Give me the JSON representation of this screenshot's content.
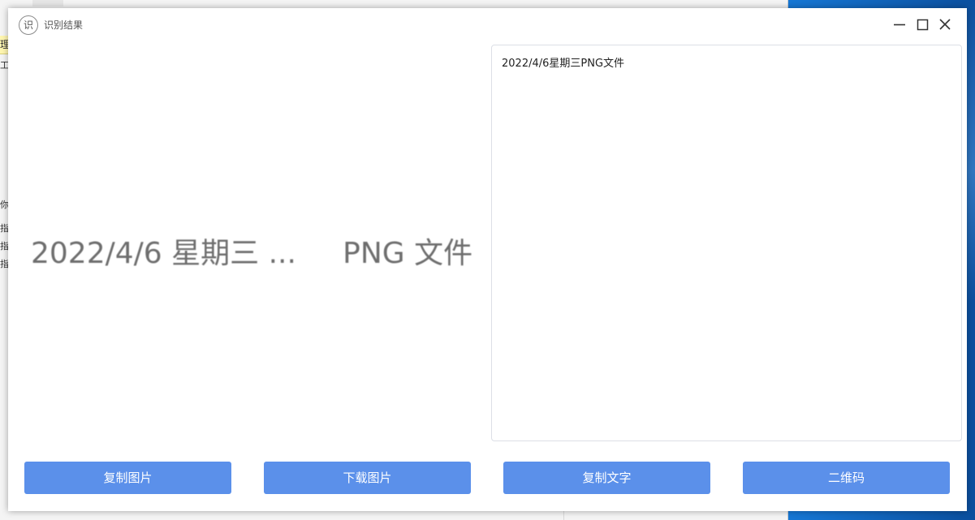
{
  "window": {
    "title": "识别结果",
    "icon_glyph": "识"
  },
  "preview": {
    "image_text": "2022/4/6 星期三 ...     PNG 文件"
  },
  "result": {
    "text": "2022/4/6星期三PNG文件"
  },
  "actions": {
    "copy_image": "复制图片",
    "download_image": "下载图片",
    "copy_text": "复制文字",
    "qrcode": "二维码"
  },
  "background_app": {
    "yellow_text": "理",
    "side_lines": [
      "工",
      "你",
      "指",
      "指",
      "指"
    ]
  },
  "colors": {
    "button_bg": "#5b90ea",
    "button_text": "#ffffff",
    "desktop": "#0a66c8"
  }
}
